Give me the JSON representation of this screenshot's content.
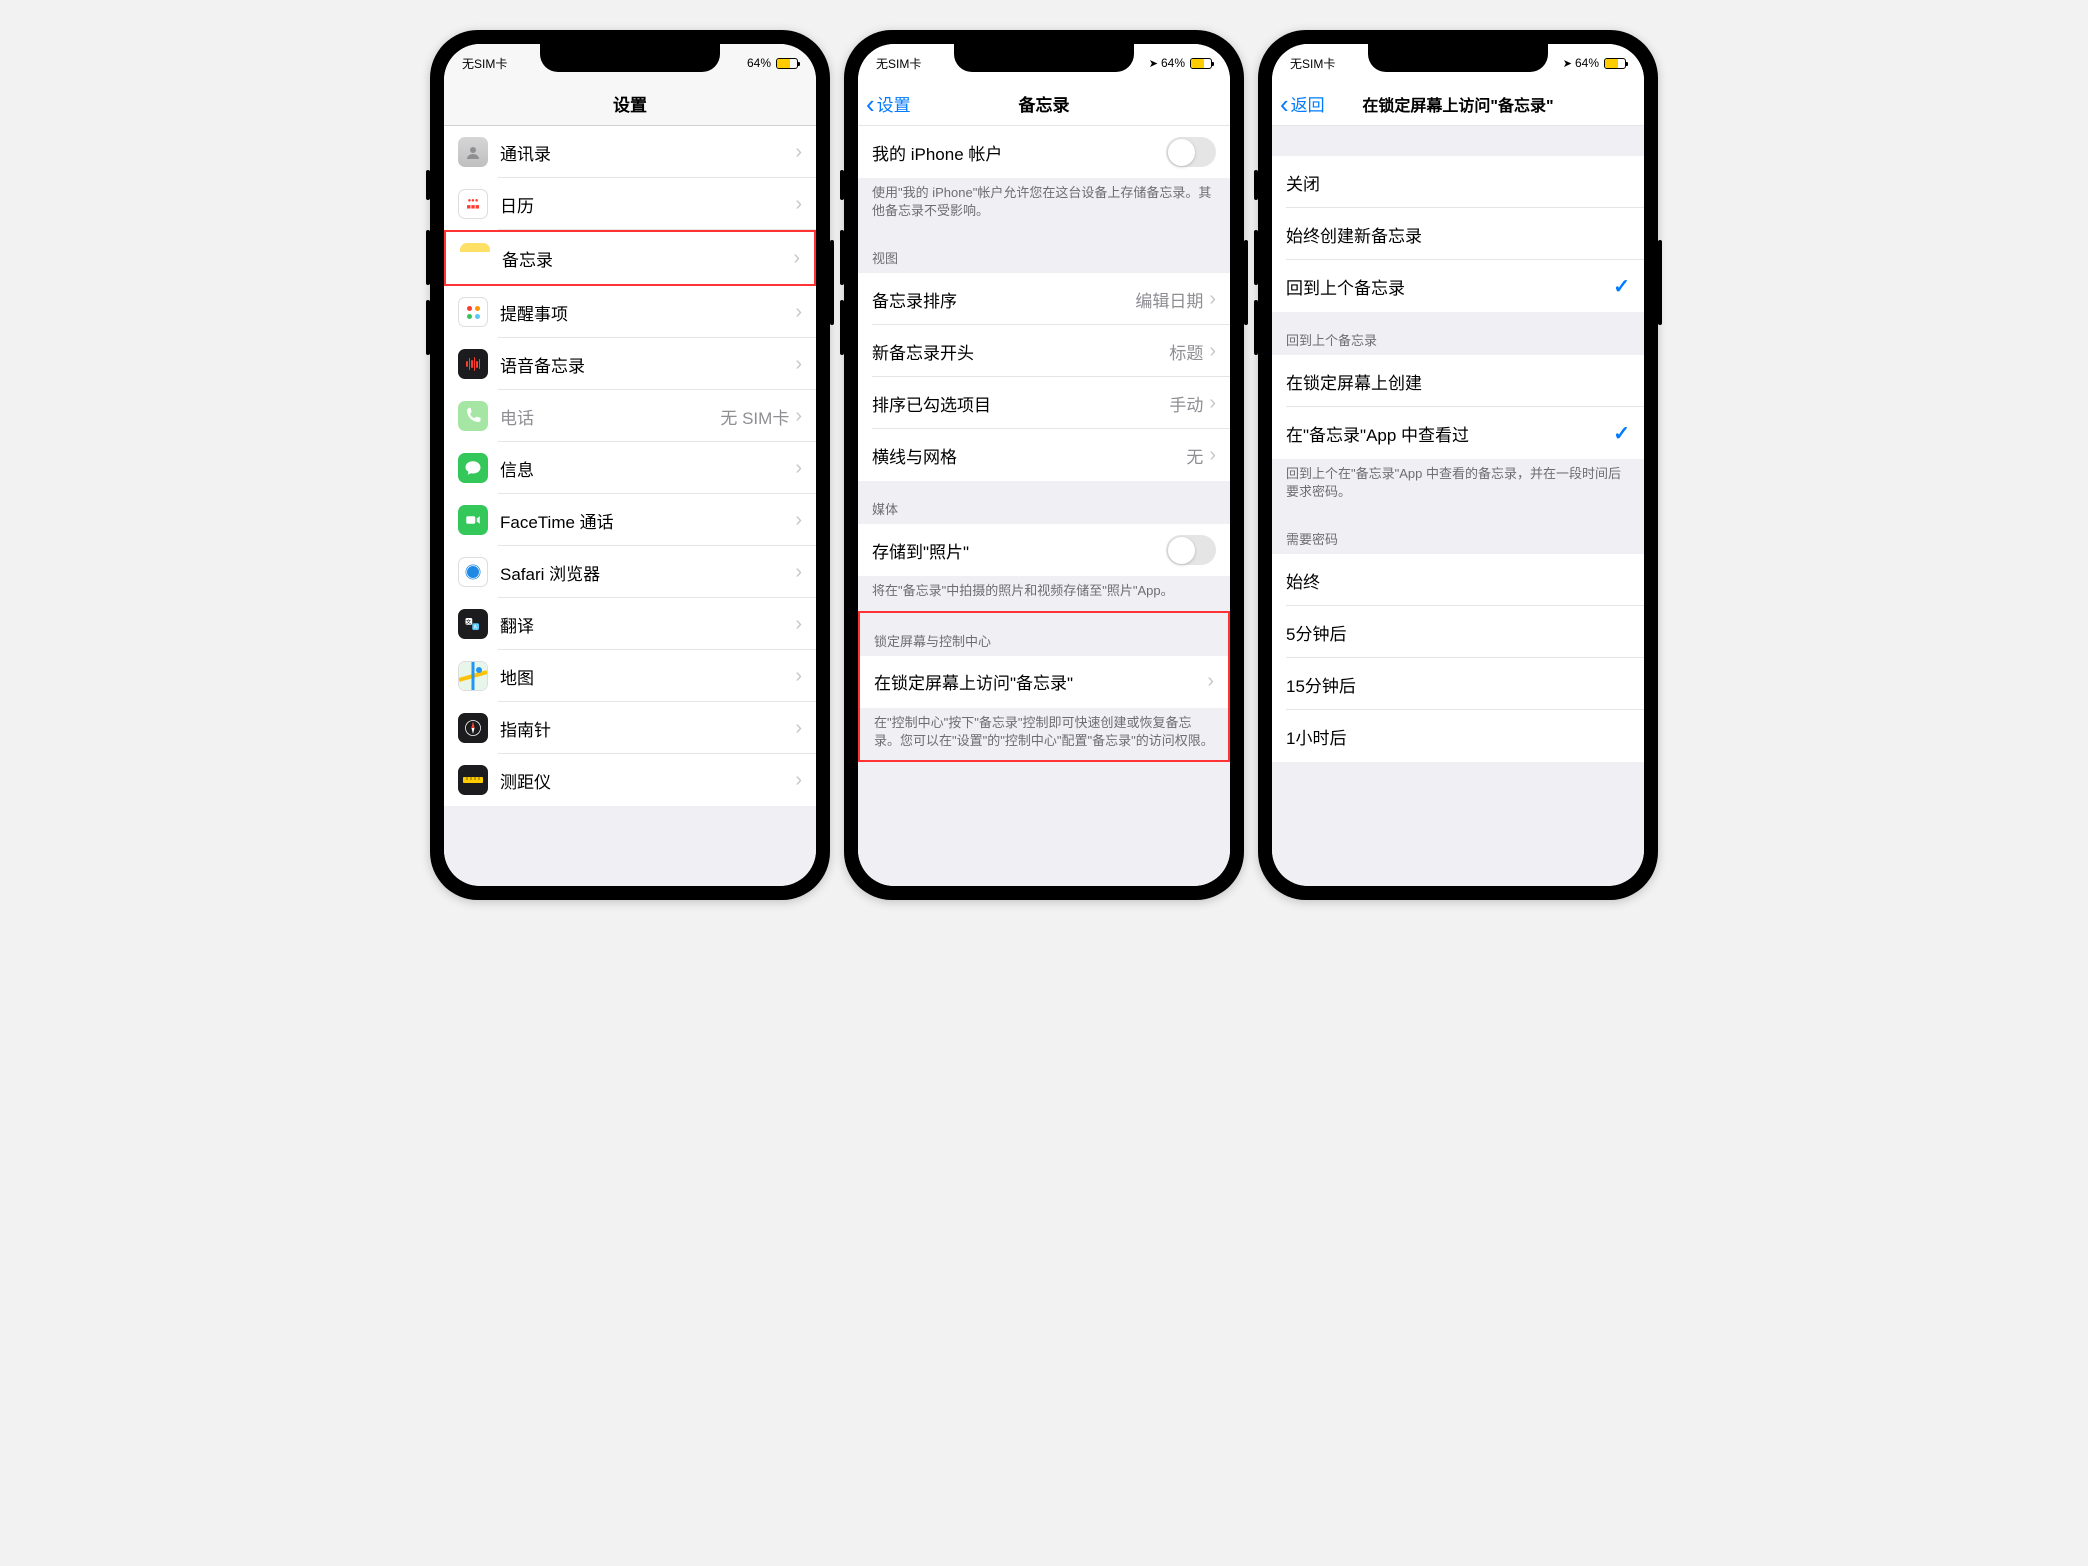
{
  "status": {
    "carrier": "无SIM卡",
    "battery_percent": "64%"
  },
  "phone1": {
    "nav_title": "设置",
    "rows": [
      {
        "label": "通讯录",
        "icon": "contacts"
      },
      {
        "label": "日历",
        "icon": "calendar"
      },
      {
        "label": "备忘录",
        "icon": "notes",
        "highlighted": true
      },
      {
        "label": "提醒事项",
        "icon": "reminders"
      },
      {
        "label": "语音备忘录",
        "icon": "voicememo"
      },
      {
        "label": "电话",
        "icon": "phone",
        "detail": "无 SIM卡"
      },
      {
        "label": "信息",
        "icon": "messages"
      },
      {
        "label": "FaceTime 通话",
        "icon": "facetime"
      },
      {
        "label": "Safari 浏览器",
        "icon": "safari"
      },
      {
        "label": "翻译",
        "icon": "translate"
      },
      {
        "label": "地图",
        "icon": "maps"
      },
      {
        "label": "指南针",
        "icon": "compass"
      },
      {
        "label": "测距仪",
        "icon": "measure"
      }
    ]
  },
  "phone2": {
    "nav_back": "设置",
    "nav_title": "备忘录",
    "top_row_label": "我的 iPhone 帐户",
    "top_footer": "使用\"我的 iPhone\"帐户允许您在这台设备上存储备忘录。其他备忘录不受影响。",
    "section_view": "视图",
    "view_rows": [
      {
        "label": "备忘录排序",
        "detail": "编辑日期"
      },
      {
        "label": "新备忘录开头",
        "detail": "标题"
      },
      {
        "label": "排序已勾选项目",
        "detail": "手动"
      },
      {
        "label": "横线与网格",
        "detail": "无"
      }
    ],
    "section_media": "媒体",
    "media_row_label": "存储到\"照片\"",
    "media_footer": "将在\"备忘录\"中拍摄的照片和视频存储至\"照片\"App。",
    "section_lock": "锁定屏幕与控制中心",
    "lock_row_label": "在锁定屏幕上访问\"备忘录\"",
    "lock_footer": "在\"控制中心\"按下\"备忘录\"控制即可快速创建或恢复备忘录。您可以在\"设置\"的\"控制中心\"配置\"备忘录\"的访问权限。"
  },
  "phone3": {
    "nav_back": "返回",
    "nav_title": "在锁定屏幕上访问\"备忘录\"",
    "mode_rows": [
      {
        "label": "关闭",
        "checked": false
      },
      {
        "label": "始终创建新备忘录",
        "checked": false
      },
      {
        "label": "回到上个备忘录",
        "checked": true
      }
    ],
    "section_resume": "回到上个备忘录",
    "resume_rows": [
      {
        "label": "在锁定屏幕上创建",
        "checked": false
      },
      {
        "label": "在\"备忘录\"App 中查看过",
        "checked": true
      }
    ],
    "resume_footer": "回到上个在\"备忘录\"App 中查看的备忘录，并在一段时间后要求密码。",
    "section_passcode": "需要密码",
    "passcode_rows": [
      {
        "label": "始终"
      },
      {
        "label": "5分钟后"
      },
      {
        "label": "15分钟后"
      },
      {
        "label": "1小时后"
      }
    ]
  }
}
